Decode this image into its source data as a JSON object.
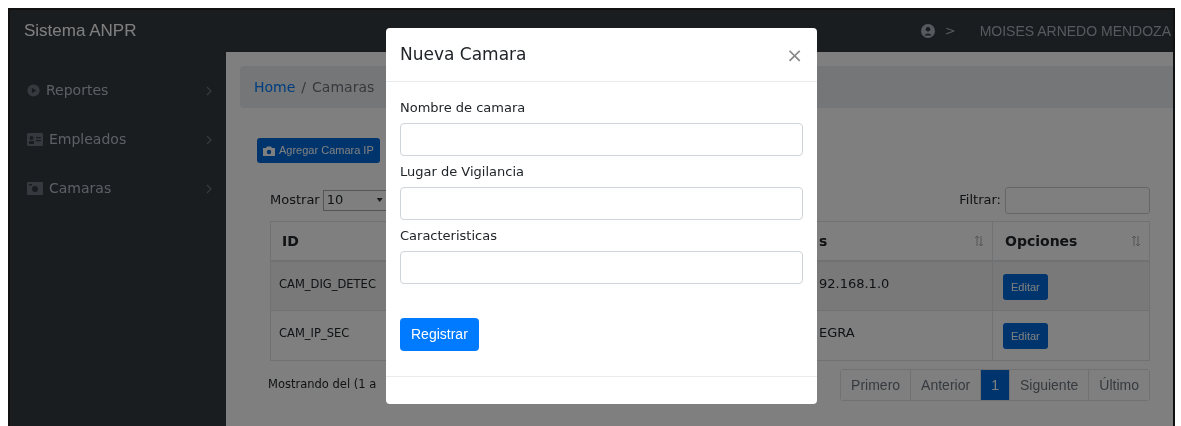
{
  "topbar": {
    "brand": "Sistema ANPR",
    "separator": ">",
    "user": "MOISES ARNEDO MENDOZA"
  },
  "sidebar": {
    "items": [
      {
        "label": "Reportes",
        "kind": "play"
      },
      {
        "label": "Empleados",
        "kind": "card"
      },
      {
        "label": "Camaras",
        "kind": "camera"
      }
    ]
  },
  "breadcrumb": [
    {
      "label": "Home",
      "kind": "link"
    },
    {
      "label": "/",
      "kind": "divider"
    },
    {
      "label": "Camaras",
      "kind": "current"
    }
  ],
  "add_button": "Agregar Camara IP",
  "length_control": {
    "label": "Mostrar",
    "value": "10"
  },
  "filter": {
    "label": "Filtrar:"
  },
  "table": {
    "columns": [
      "ID",
      "s",
      "Opciones"
    ],
    "rows": [
      {
        "id": "CAM_DIG_DETEC",
        "column_3": "92.168.1.0",
        "action": "Editar"
      },
      {
        "id": "CAM_IP_SEC",
        "column_3": "EGRA",
        "action": "Editar"
      }
    ]
  },
  "info": "Mostrando del (1 a",
  "pagination": [
    {
      "label": "Primero",
      "selected": false
    },
    {
      "label": "Anterior",
      "selected": false
    },
    {
      "label": "1",
      "selected": true
    },
    {
      "label": "Siguiente",
      "selected": false
    },
    {
      "label": "Último",
      "selected": false
    }
  ],
  "modal": {
    "title": "Nueva Camara",
    "close": "×",
    "fields": [
      {
        "label": "Nombre de camara"
      },
      {
        "label": "Lugar de Vigilancia"
      },
      {
        "label": "Caracteristicas"
      }
    ],
    "submit": "Registrar"
  }
}
